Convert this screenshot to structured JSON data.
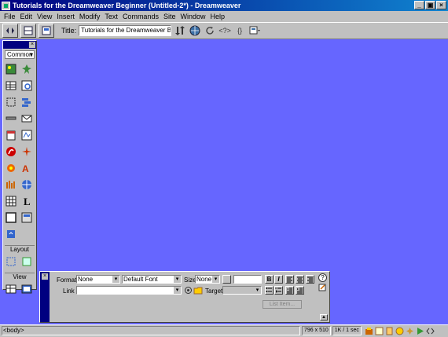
{
  "window": {
    "title": "Tutorials for the Dreamweaver Beginner (Untitled-2*) - Dreamweaver",
    "buttons": [
      "_",
      "▣",
      "×"
    ]
  },
  "menu": [
    "File",
    "Edit",
    "View",
    "Insert",
    "Modify",
    "Text",
    "Commands",
    "Site",
    "Window",
    "Help"
  ],
  "toolbar": {
    "title_label": "Title:",
    "title_value": "Tutorials for the Dreamweaver Be",
    "codehint": "<?>",
    "braces": "{}"
  },
  "objects_panel": {
    "category": "Common",
    "layout_label": "Layout",
    "view_label": "View"
  },
  "properties": {
    "format_label": "Format",
    "format_value": "None",
    "font_value": "Default Font",
    "size_label": "Size",
    "size_value": "None",
    "bold": "B",
    "italic": "I",
    "link_label": "Link",
    "target_label": "Target",
    "list_item": "List Item..."
  },
  "status": {
    "tag": "<body>",
    "size": "796 x 510",
    "download": "1K / 1 sec"
  },
  "colors": {
    "workspace": "#6666ff",
    "titlebar": "#000080"
  }
}
